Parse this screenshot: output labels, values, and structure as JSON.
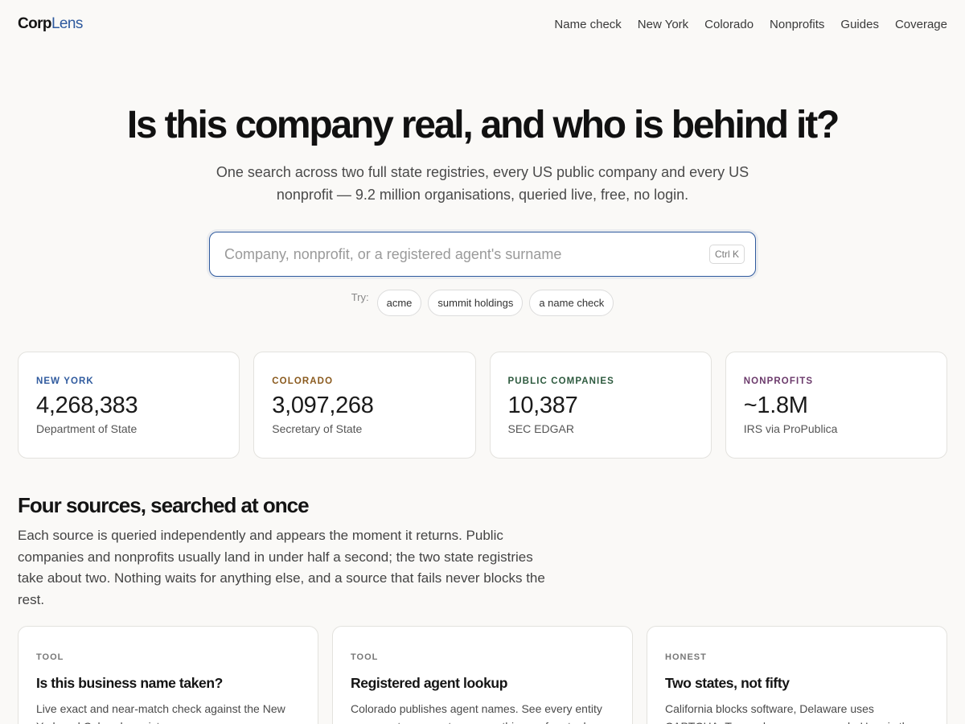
{
  "brand": {
    "part1": "Corp",
    "part2": "Lens",
    "accent": "#2f5a9e"
  },
  "nav": [
    "Name check",
    "New York",
    "Colorado",
    "Nonprofits",
    "Guides",
    "Coverage"
  ],
  "hero": {
    "title": "Is this company real, and who is behind it?",
    "subtitle": "One search across two full state registries, every US public company and every US nonprofit — 9.2 million organisations, queried live, free, no login."
  },
  "search": {
    "placeholder": "Company, nonprofit, or a registered agent's surname",
    "value": "",
    "shortcut": "Ctrl K",
    "try_label": "Try:",
    "suggestions": [
      "acme",
      "summit holdings",
      "a name check"
    ]
  },
  "stats": [
    {
      "label": "NEW YORK",
      "value": "4,268,383",
      "source": "Department of State",
      "color": "#2f5a9e"
    },
    {
      "label": "COLORADO",
      "value": "3,097,268",
      "source": "Secretary of State",
      "color": "#8a5a1e"
    },
    {
      "label": "PUBLIC COMPANIES",
      "value": "10,387",
      "source": "SEC EDGAR",
      "color": "#2d5a3e"
    },
    {
      "label": "NONPROFITS",
      "value": "~1.8M",
      "source": "IRS via ProPublica",
      "color": "#6b3a6b"
    }
  ],
  "section": {
    "title": "Four sources, searched at once",
    "body": "Each source is queried independently and appears the moment it returns. Public companies and nonprofits usually land in under half a second; the two state registries take about two. Nothing waits for anything else, and a source that fails never blocks the rest."
  },
  "cards": [
    {
      "kicker": "TOOL",
      "title": "Is this business name taken?",
      "body": "Live exact and near-match check against the New York and Colorado registers."
    },
    {
      "kicker": "TOOL",
      "title": "Registered agent lookup",
      "body": "Colorado publishes agent names. See every entity one agent represents — something no free tool"
    },
    {
      "kicker": "HONEST",
      "title": "Two states, not fifty",
      "body": "California blocks software, Delaware uses CAPTCHA, Texas charges per search. Here is the"
    }
  ]
}
